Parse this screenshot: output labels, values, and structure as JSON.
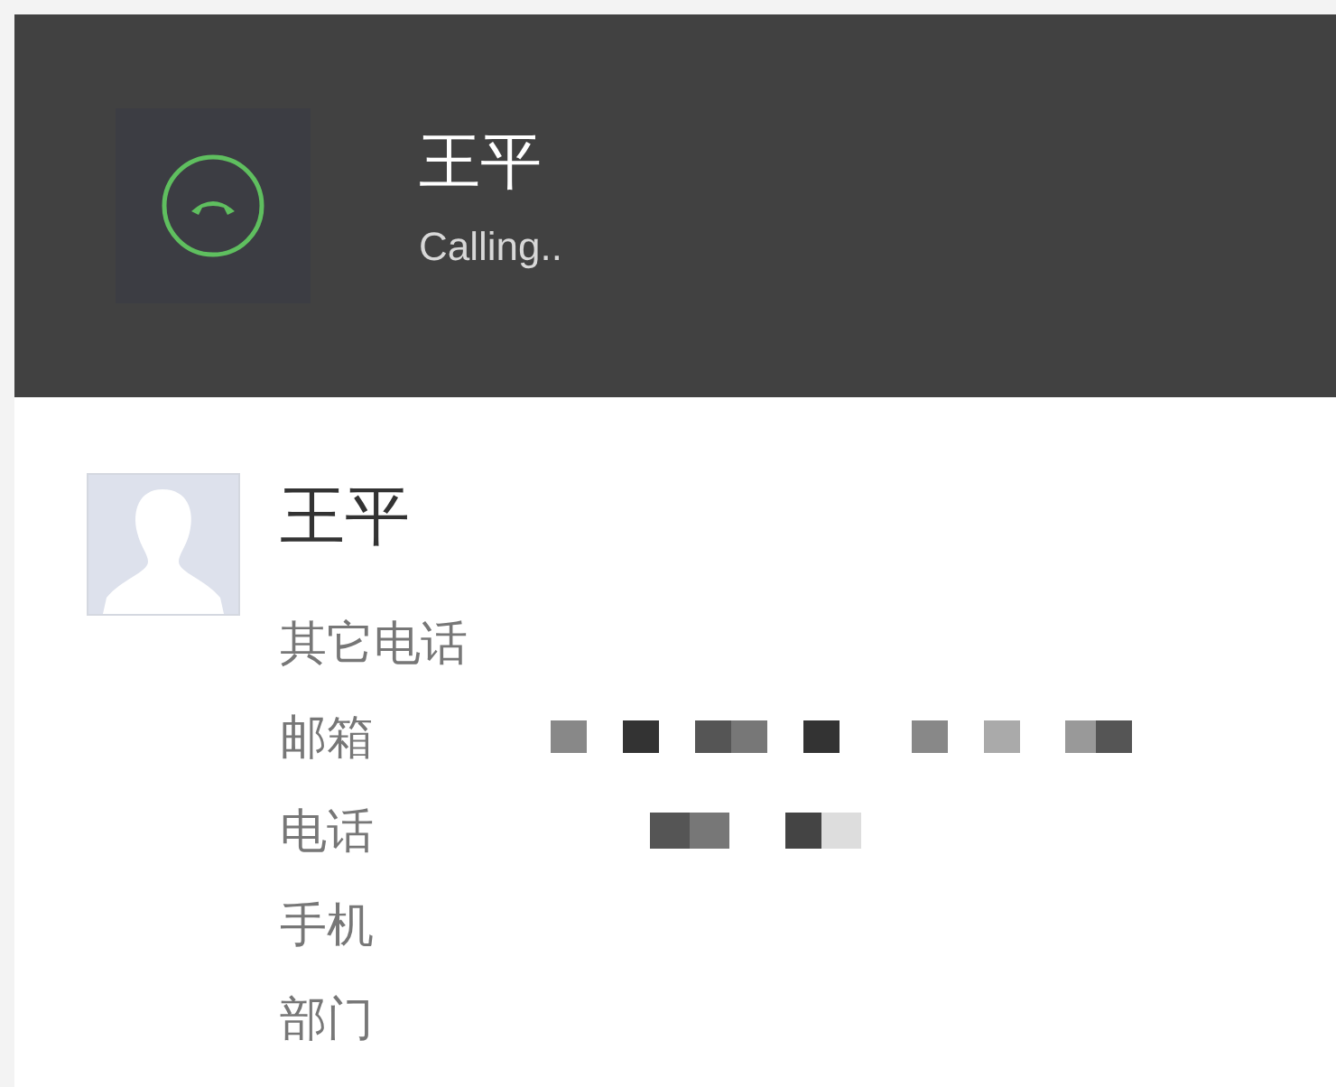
{
  "call_header": {
    "name": "王平",
    "status": "Calling.."
  },
  "contact": {
    "name": "王平",
    "fields": [
      {
        "label": "其它电话",
        "redacted": false
      },
      {
        "label": "邮箱",
        "redacted": true
      },
      {
        "label": "电话",
        "redacted": true
      },
      {
        "label": "手机",
        "redacted": false
      },
      {
        "label": "部门",
        "redacted": false
      }
    ]
  }
}
